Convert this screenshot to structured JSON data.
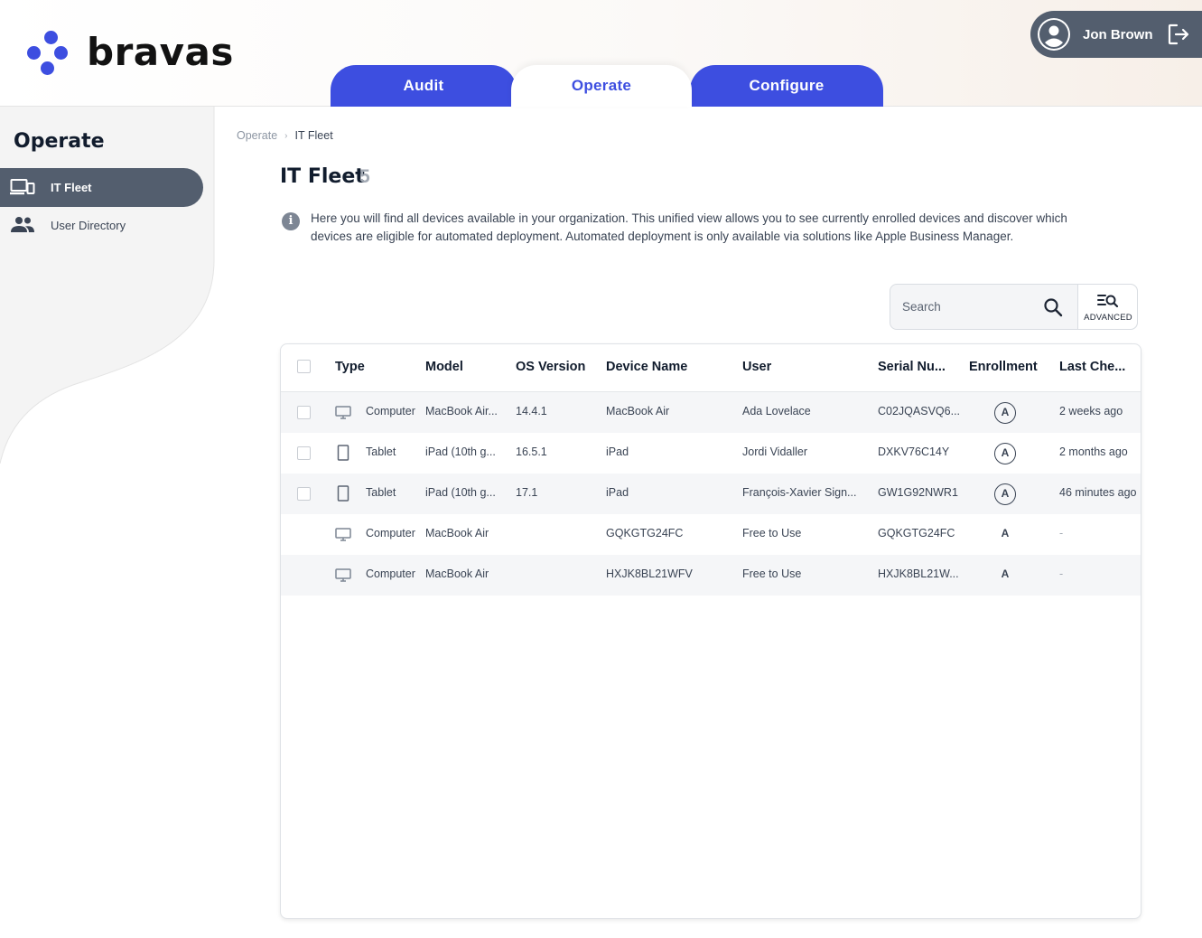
{
  "brand": {
    "name": "bravas",
    "accent": "#3d4ee0"
  },
  "tabs": [
    {
      "label": "Audit",
      "active": false
    },
    {
      "label": "Operate",
      "active": true
    },
    {
      "label": "Configure",
      "active": false
    }
  ],
  "user": {
    "name": "Jon Brown",
    "avatar_icon": "user-circle-icon",
    "logout_icon": "logout-icon"
  },
  "sidebar": {
    "title": "Operate",
    "items": [
      {
        "label": "IT Fleet",
        "icon": "devices-icon",
        "active": true
      },
      {
        "label": "User Directory",
        "icon": "people-icon",
        "active": false
      }
    ]
  },
  "breadcrumb": {
    "parent": "Operate",
    "separator": "›",
    "current": "IT Fleet"
  },
  "page": {
    "title": "IT Fleet",
    "count": "5",
    "info": "Here you will find all devices available in your organization. This unified view allows you to see currently enrolled devices and discover which devices are eligible for automated deployment. Automated deployment is only available via solutions like Apple Business Manager."
  },
  "search": {
    "placeholder": "Search",
    "advanced_label": "ADVANCED"
  },
  "table": {
    "columns": [
      "Type",
      "Model",
      "OS Version",
      "Device Name",
      "User",
      "Serial Nu...",
      "Enrollment",
      "Last Che..."
    ],
    "rows": [
      {
        "type": "Computer",
        "icon": "monitor-icon",
        "model": "MacBook Air...",
        "os": "14.4.1",
        "device": "MacBook Air",
        "user": "Ada Lovelace",
        "serial": "C02JQASVQ6...",
        "enrollment": "A",
        "enrollment_style": "circled",
        "last": "2 weeks ago",
        "selectable": true
      },
      {
        "type": "Tablet",
        "icon": "tablet-icon",
        "model": "iPad (10th g...",
        "os": "16.5.1",
        "device": "iPad",
        "user": "Jordi Vidaller",
        "serial": "DXKV76C14Y",
        "enrollment": "A",
        "enrollment_style": "circled",
        "last": "2 months ago",
        "selectable": true
      },
      {
        "type": "Tablet",
        "icon": "tablet-icon",
        "model": "iPad (10th g...",
        "os": "17.1",
        "device": "iPad",
        "user": "François-Xavier Sign...",
        "serial": "GW1G92NWR1",
        "enrollment": "A",
        "enrollment_style": "circled",
        "last": "46 minutes ago",
        "selectable": true
      },
      {
        "type": "Computer",
        "icon": "monitor-icon",
        "model": "MacBook Air",
        "os": "",
        "device": "GQKGTG24FC",
        "user": "Free to Use",
        "serial": "GQKGTG24FC",
        "enrollment": "A",
        "enrollment_style": "plain",
        "last": "-",
        "selectable": false
      },
      {
        "type": "Computer",
        "icon": "monitor-icon",
        "model": "MacBook Air",
        "os": "",
        "device": "HXJK8BL21WFV",
        "user": "Free to Use",
        "serial": "HXJK8BL21W...",
        "enrollment": "A",
        "enrollment_style": "plain",
        "last": "-",
        "selectable": false
      }
    ]
  }
}
